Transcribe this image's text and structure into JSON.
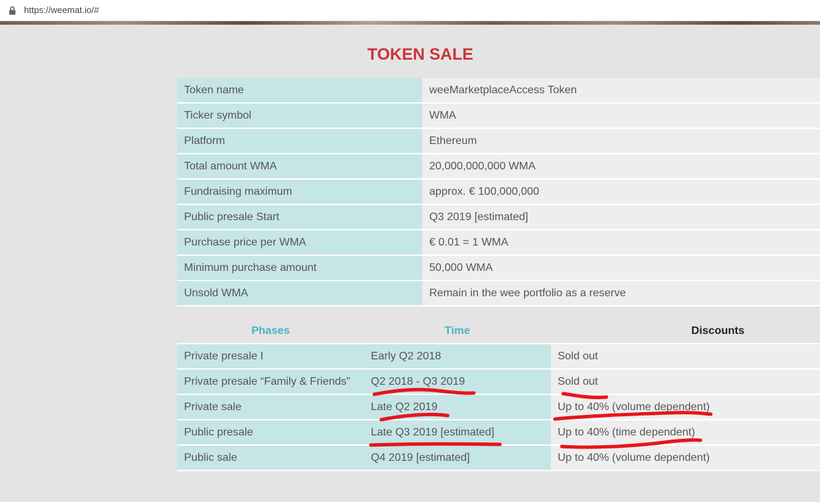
{
  "browser": {
    "url": "https://weemat.io/#",
    "lock_icon": "lock-icon"
  },
  "token_sale": {
    "title": "TOKEN SALE",
    "rows": [
      {
        "label": "Token name",
        "value": "weeMarketplaceAccess Token"
      },
      {
        "label": "Ticker symbol",
        "value": "WMA"
      },
      {
        "label": "Platform",
        "value": "Ethereum"
      },
      {
        "label": "Total amount WMA",
        "value": "20,000,000,000 WMA"
      },
      {
        "label": "Fundraising maximum",
        "value": "approx. € 100,000,000"
      },
      {
        "label": "Public presale Start",
        "value": "Q3 2019 [estimated]"
      },
      {
        "label": "Purchase price per WMA",
        "value": "€ 0.01 = 1 WMA"
      },
      {
        "label": "Minimum purchase amount",
        "value": "50,000 WMA"
      },
      {
        "label": "Unsold WMA",
        "value": "Remain in the wee portfolio as a reserve"
      }
    ]
  },
  "phases_table": {
    "headers": {
      "phases": "Phases",
      "time": "Time",
      "discounts": "Discounts"
    },
    "rows": [
      {
        "phase": "Private presale I",
        "time": "Early Q2 2018",
        "discount": "Sold out"
      },
      {
        "phase": "Private presale “Family & Friends”",
        "time": "Q2 2018 - Q3 2019",
        "discount": "Sold out"
      },
      {
        "phase": "Private sale",
        "time": "Late Q2 2019",
        "discount": "Up to 40% (volume dependent)"
      },
      {
        "phase": "Public presale",
        "time": "Late Q3 2019 [estimated]",
        "discount": "Up to 40% (time dependent)"
      },
      {
        "phase": "Public sale",
        "time": "Q4 2019 [estimated]",
        "discount": "Up to 40% (volume dependent)"
      }
    ]
  },
  "colors": {
    "title": "#c8343e",
    "key_cell": "#c6e5e7",
    "value_cell": "#eeeeee",
    "header_accent": "#4fb3bf",
    "annotation": "#e8141c"
  }
}
